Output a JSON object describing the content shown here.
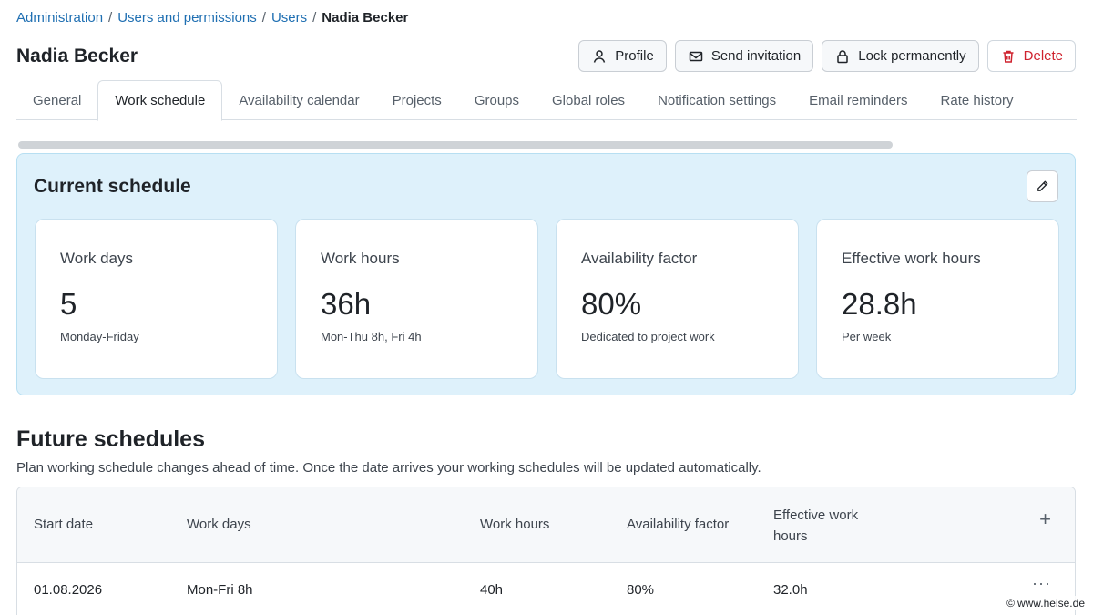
{
  "breadcrumb": {
    "items": [
      "Administration",
      "Users and permissions",
      "Users"
    ],
    "separator": "/",
    "current": "Nadia Becker"
  },
  "page": {
    "title": "Nadia Becker"
  },
  "actions": {
    "profile": "Profile",
    "send_invitation": "Send invitation",
    "lock_permanently": "Lock permanently",
    "delete": "Delete"
  },
  "tabs": [
    {
      "label": "General"
    },
    {
      "label": "Work schedule",
      "active": true
    },
    {
      "label": "Availability calendar"
    },
    {
      "label": "Projects"
    },
    {
      "label": "Groups"
    },
    {
      "label": "Global roles"
    },
    {
      "label": "Notification settings"
    },
    {
      "label": "Email reminders"
    },
    {
      "label": "Rate history"
    }
  ],
  "current_schedule": {
    "title": "Current schedule",
    "cards": [
      {
        "label": "Work days",
        "value": "5",
        "sub": "Monday-Friday"
      },
      {
        "label": "Work hours",
        "value": "36h",
        "sub": "Mon-Thu 8h, Fri 4h"
      },
      {
        "label": "Availability factor",
        "value": "80%",
        "sub": "Dedicated to project work"
      },
      {
        "label": "Effective work hours",
        "value": "28.8h",
        "sub": "Per week"
      }
    ]
  },
  "future_schedules": {
    "title": "Future schedules",
    "description": "Plan working schedule changes ahead of time. Once the date arrives your working schedules will be updated automatically.",
    "columns": [
      "Start date",
      "Work days",
      "Work hours",
      "Availability factor",
      "Effective work hours"
    ],
    "add_symbol": "+",
    "rows": [
      {
        "start_date": "01.08.2026",
        "work_days": "Mon-Fri 8h",
        "work_hours": "40h",
        "availability_factor": "80%",
        "effective_work_hours": "32.0h"
      }
    ],
    "more_symbol": "···"
  },
  "watermark": {
    "symbol": "©",
    "text": "www.heise.de"
  },
  "colors": {
    "link": "#1f6fb2",
    "danger": "#cf222e",
    "panel_bg": "#def1fb"
  },
  "icons": [
    "user-icon",
    "envelope-icon",
    "lock-icon",
    "trash-icon",
    "pencil-icon",
    "plus-icon",
    "more-icon"
  ]
}
